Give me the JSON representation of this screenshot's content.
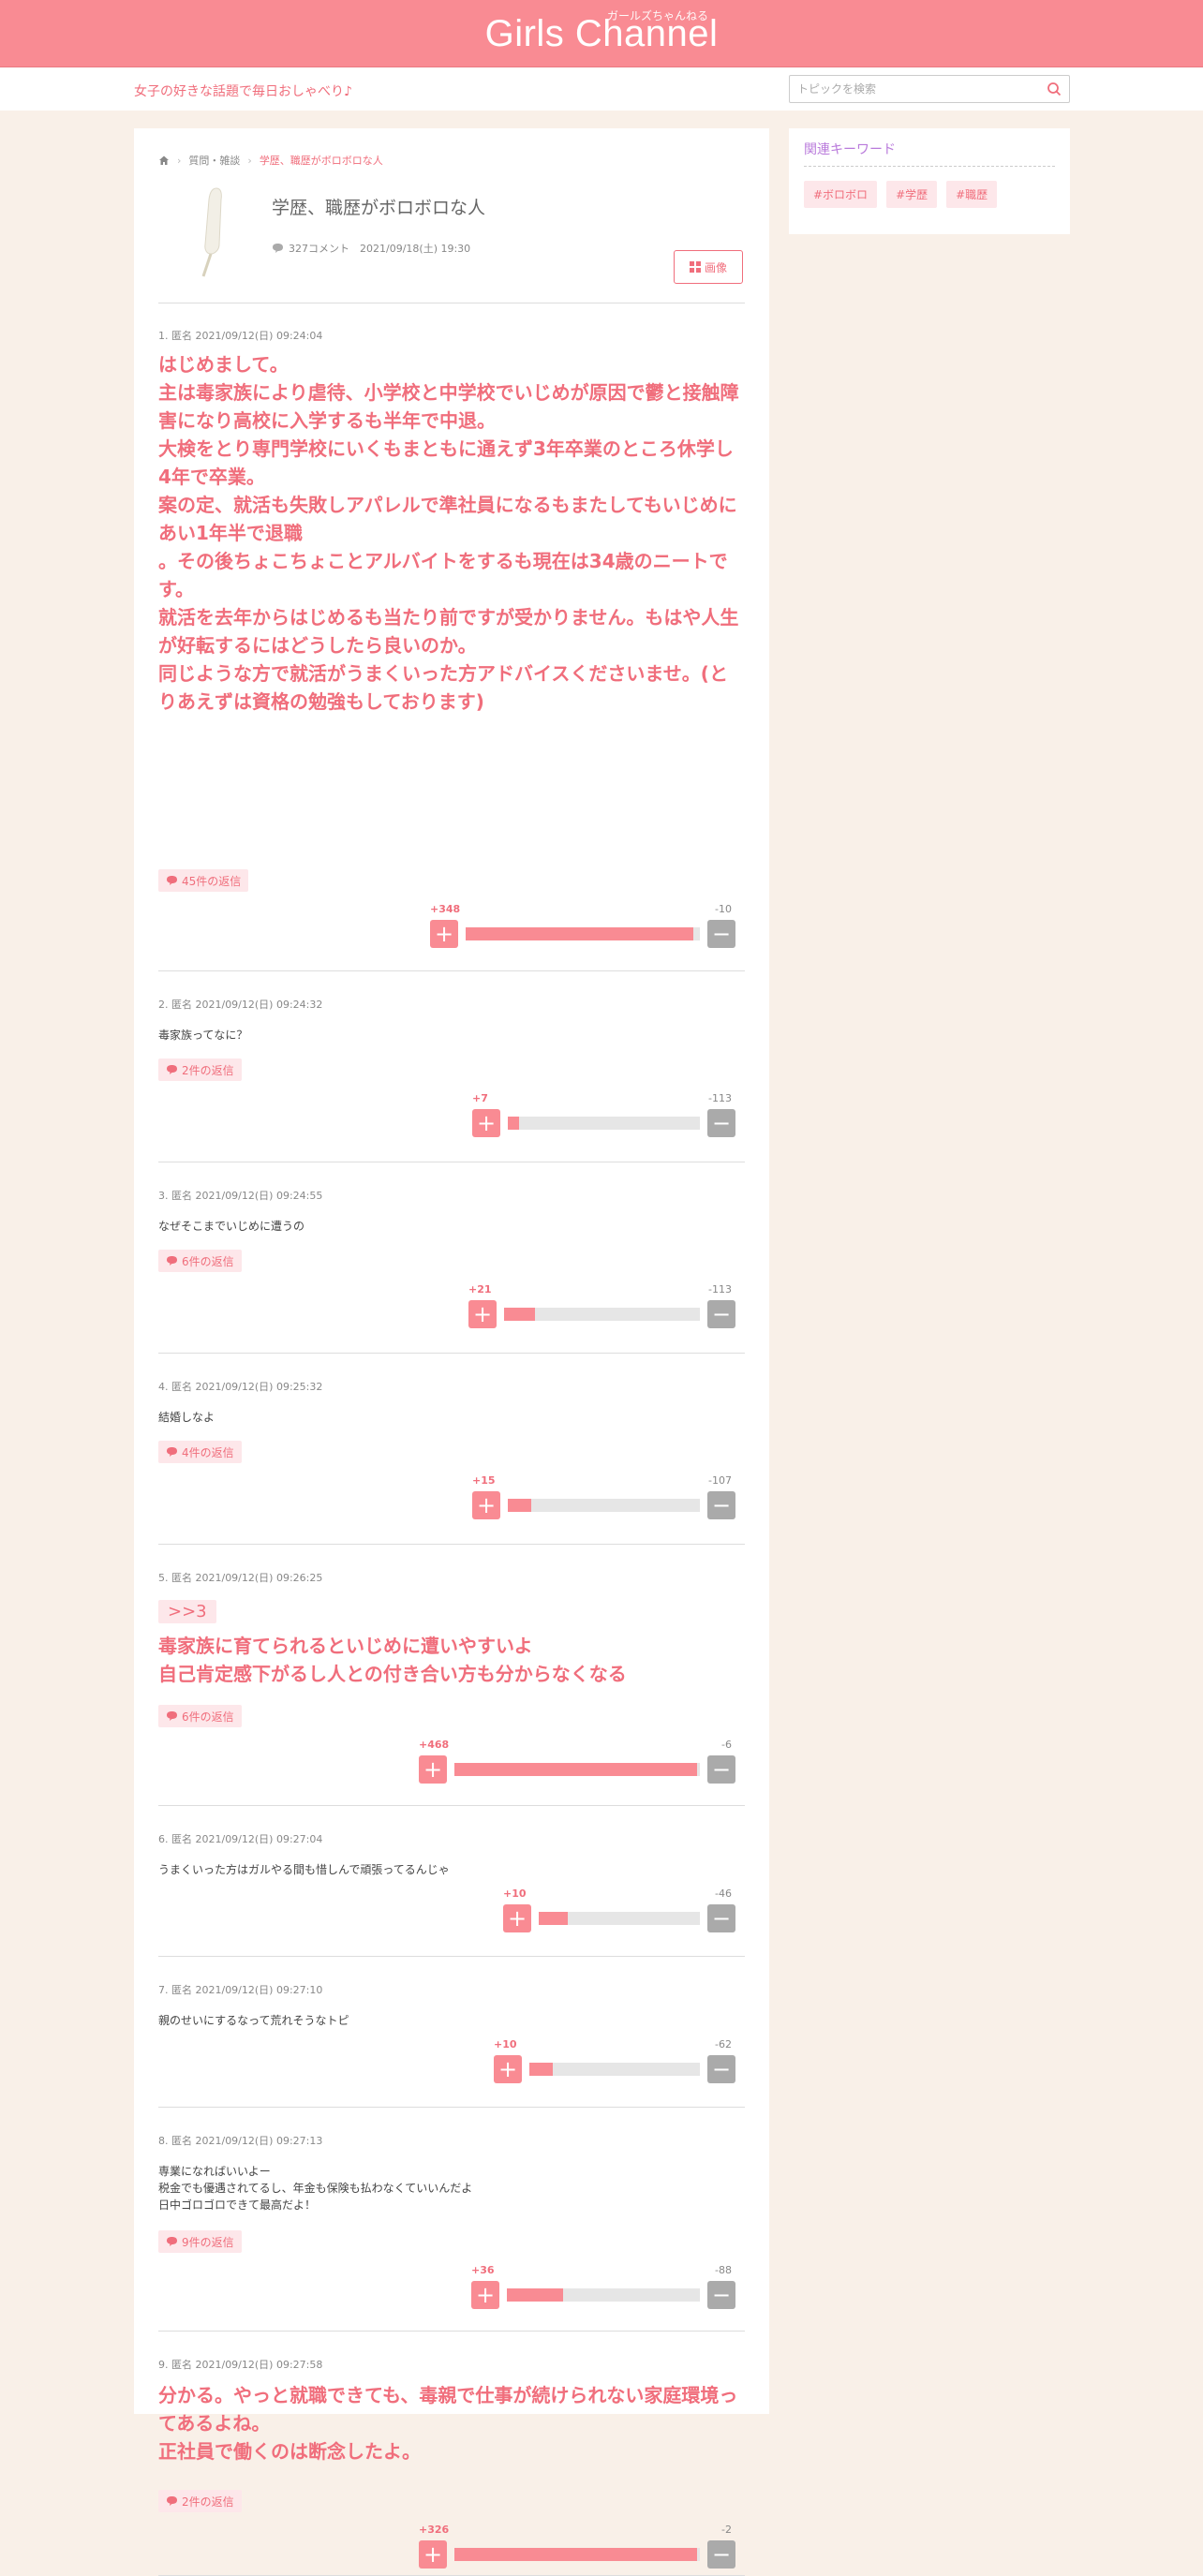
{
  "site": {
    "logo": "Girls Channel",
    "logo_sub": "ガールズちゃんねる",
    "tagline": "女子の好きな話題で毎日おしゃべり♪",
    "search_placeholder": "トピックを検索"
  },
  "breadcrumb": [
    "質問・雑談",
    "学歴、職歴がボロボロな人"
  ],
  "topic": {
    "title": "学歴、職歴がボロボロな人",
    "comment_count": "327コメント",
    "date": "2021/09/18(土) 19:30",
    "image_button": "画像"
  },
  "comments": [
    {
      "header": "1. 匿名 2021/09/12(日) 09:24:04",
      "body": "はじめまして。\n主は毒家族により虐待、小学校と中学校でいじめが原因で鬱と接触障害になり高校に入学するも半年で中退。\n大検をとり専門学校にいくもまともに通えず3年卒業のところ休学し4年で卒業。\n案の定、就活も失敗しアパレルで準社員になるもまたしてもいじめにあい1年半で退職\n。その後ちょこちょことアルバイトをするも現在は34歳のニートです。\n就活を去年からはじめるも当たり前ですが受かりません。もはや人生が好転するにはどうしたら良いのか。\n同じような方で就活がうまくいった方アドバイスくださいませ。(とりあえずは資格の勉強もしております)",
      "replies": "45件の返信",
      "plus": "+348",
      "minus": "-10",
      "ratio": 0.97
    },
    {
      "header": "2. 匿名 2021/09/12(日) 09:24:32",
      "body": "毒家族ってなに？",
      "replies": "2件の返信",
      "plus": "+7",
      "minus": "-113",
      "ratio": 0.06
    },
    {
      "header": "3. 匿名 2021/09/12(日) 09:24:55",
      "body": "なぜそこまでいじめに遭うの",
      "replies": "6件の返信",
      "plus": "+21",
      "minus": "-113",
      "ratio": 0.16
    },
    {
      "header": "4. 匿名 2021/09/12(日) 09:25:32",
      "body": "結婚しなよ",
      "replies": "4件の返信",
      "plus": "+15",
      "minus": "-107",
      "ratio": 0.12
    },
    {
      "header": "5. 匿名 2021/09/12(日) 09:26:25",
      "anchor": ">>3",
      "body": "毒家族に育てられるといじめに遭いやすいよ\n自己肯定感下がるし人との付き合い方も分からなくなる",
      "replies": "6件の返信",
      "plus": "+468",
      "minus": "-6",
      "ratio": 0.99
    },
    {
      "header": "6. 匿名 2021/09/12(日) 09:27:04",
      "body": "うまくいった方はガルやる間も惜しんで頑張ってるんじゃ",
      "plus": "+10",
      "minus": "-46",
      "ratio": 0.18
    },
    {
      "header": "7. 匿名 2021/09/12(日) 09:27:10",
      "body": "親のせいにするなって荒れそうなトピ",
      "plus": "+10",
      "minus": "-62",
      "ratio": 0.14
    },
    {
      "header": "8. 匿名 2021/09/12(日) 09:27:13",
      "body": "専業になればいいよー\n税金でも優遇されてるし、年金も保険も払わなくていいんだよ\n日中ゴロゴロできて最高だよ！",
      "replies": "9件の返信",
      "plus": "+36",
      "minus": "-88",
      "ratio": 0.29
    },
    {
      "header": "9. 匿名 2021/09/12(日) 09:27:58",
      "body": "分かる。やっと就職できても、毒親で仕事が続けられない家庭環境ってあるよね。\n正社員で働くのは断念したよ。",
      "replies": "2件の返信",
      "plus": "+326",
      "minus": "-2",
      "ratio": 0.99
    }
  ],
  "sidebar": {
    "keywords_title": "関連キーワード",
    "keywords": [
      "#ボロボロ",
      "#学歴",
      "#職歴"
    ]
  }
}
